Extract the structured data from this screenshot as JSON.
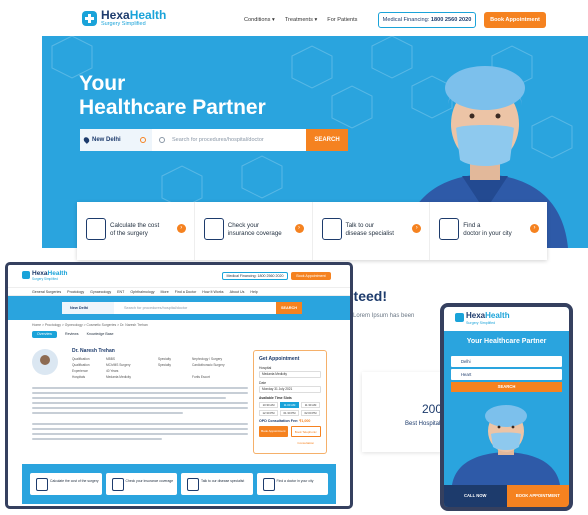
{
  "brand": {
    "name_a": "Hexa",
    "name_b": "Health",
    "tagline": "Surgery Simplified"
  },
  "header": {
    "nav": [
      "Conditions",
      "Treatments",
      "For Patients"
    ],
    "financing_label": "Medical Financing: ",
    "financing_number": "1800 2560 2020",
    "book_label": "Book Appointment"
  },
  "hero": {
    "title_line1": "Your",
    "title_line2": "Healthcare Partner",
    "location": "New Delhi",
    "search_placeholder": "Search for procedures/hospital/doctor",
    "search_button": "SEARCH"
  },
  "features": [
    {
      "line1": "Calculate the cost",
      "line2": "of the surgery",
      "icon": "calculator-icon"
    },
    {
      "line1": "Check your",
      "line2": "insurance coverage",
      "icon": "insurance-icon"
    },
    {
      "line1": "Talk to our",
      "line2": "disease specialist",
      "icon": "doctor-icon"
    },
    {
      "line1": "Find a",
      "line2": "doctor in your city",
      "icon": "nurse-icon"
    }
  ],
  "peek": {
    "title": "nteed!",
    "subtitle": "Lorem Ipsum has been",
    "number": "200",
    "label": "Best Hospital"
  },
  "laptop": {
    "financing": "Medical Financing: 1800 2560 2020",
    "book": "Book Appointment",
    "nav": [
      "General Surgeries",
      "Proctology",
      "Gynaecology",
      "ENT",
      "Ophthalmology",
      "More",
      "Find a Doctor",
      "How It Works",
      "About Us",
      "Help"
    ],
    "location": "New Delhi",
    "search_placeholder": "Search for procedures/hospital/doctor",
    "search_button": "SEARCH",
    "breadcrumb": "Home > Proctology > Gynecology > Cosmetic Surgeries > Dr. Naresh Trehan",
    "tabs": [
      "Overview",
      "Reviews",
      "Knowledge Base"
    ],
    "doctor_name": "Dr. Naresh Trehan",
    "doctor_rows": [
      [
        "Qualification",
        "MBBS",
        "Specialty",
        "Nephrology / Surgery"
      ],
      [
        "Qualification",
        "MCh/MS Surgery",
        "Specialty",
        "Cardiothoracic Surgery"
      ],
      [
        "Experience",
        "40 Years",
        "",
        ""
      ],
      [
        "Hospitals",
        "Medanta Medicity",
        "",
        "Fortis Escort"
      ]
    ],
    "appointment": {
      "title": "Get Appointment",
      "hospital_label": "Hospital",
      "hospital_value": "Medanta Medicity",
      "date_label": "Date",
      "date_value": "Monday 31 July 2021",
      "slots_label": "Available Time Slots",
      "slots": [
        "10:30 AM",
        "11:00 AM",
        "11:30 AM",
        "12:30 PM",
        "01:30 PM",
        "02:00 PM"
      ],
      "fee_label": "OPD Consultation Fee: ",
      "fee_value": "₹1,000",
      "btn1": "Book Appointment",
      "btn2": "Book Telephonic Consultation"
    },
    "features": [
      "Calculate the cost of the surgery",
      "Check your insurance coverage",
      "Talk to our disease specialist",
      "Find a doctor in your city"
    ]
  },
  "phone": {
    "title": "Your Healthcare Partner",
    "location": "Delhi",
    "query": "Heart",
    "search_button": "SEARCH",
    "call": "CALL NOW",
    "book": "BOOK APPOINTMENT"
  },
  "colors": {
    "primary": "#2aa4de",
    "accent": "#f58220",
    "navy": "#1d3b6c",
    "frame": "#35405f"
  }
}
